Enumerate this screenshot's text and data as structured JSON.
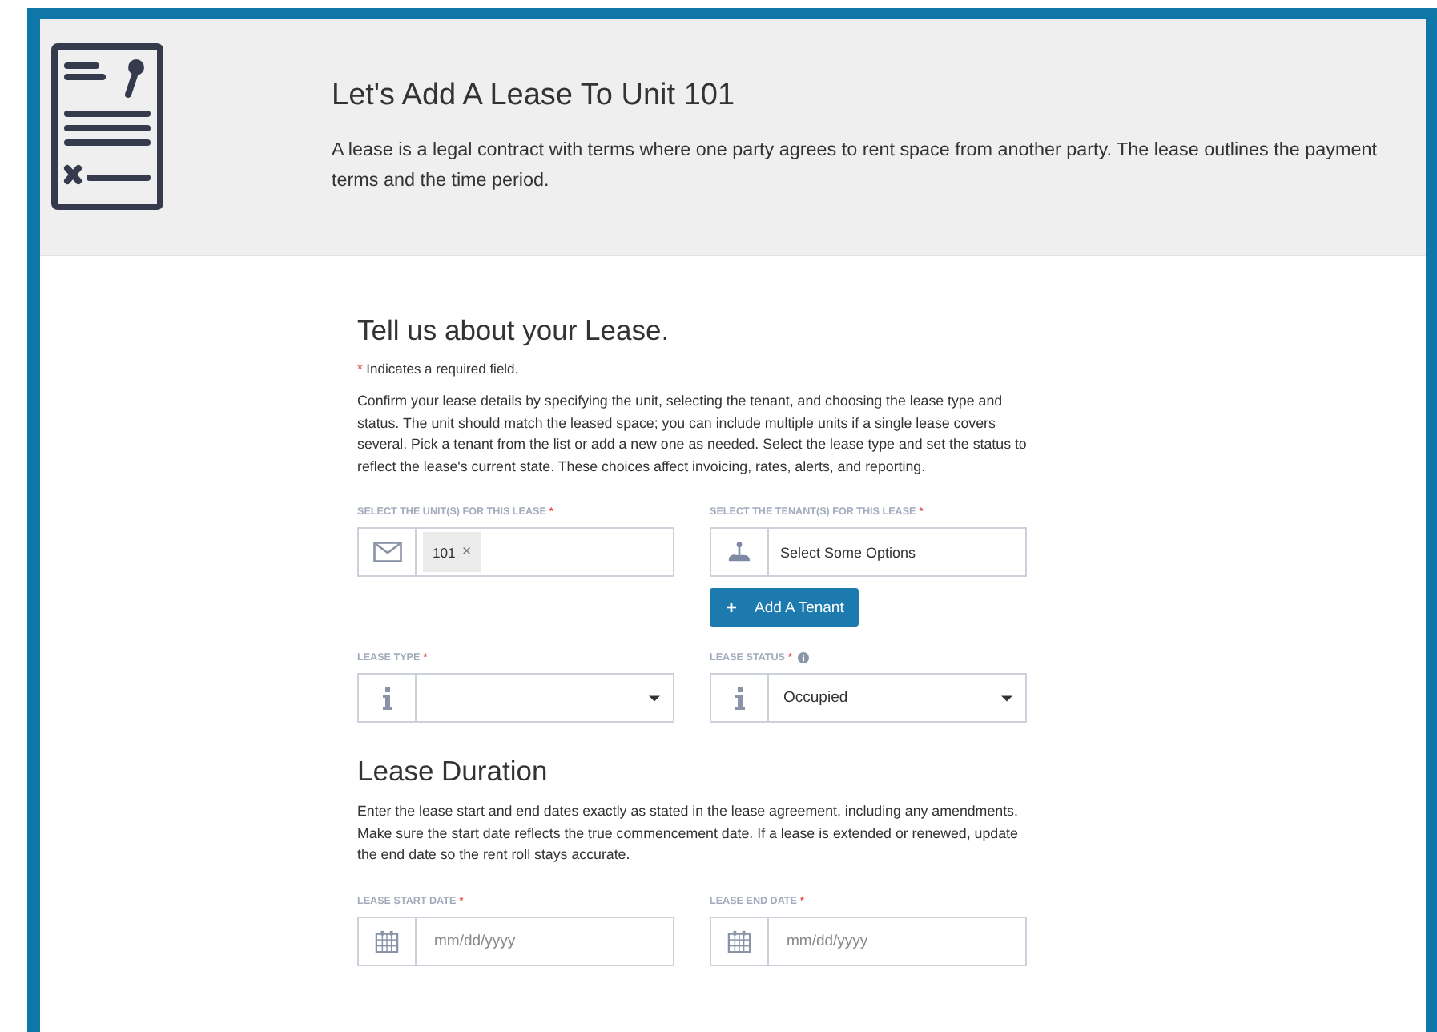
{
  "header": {
    "title": "Let's Add A Lease To Unit 101",
    "description": "A lease is a legal contract with terms where one party agrees to rent space from another party. The lease outlines the payment terms and the time period."
  },
  "sections": [
    {
      "heading": "Tell us about your Lease.",
      "required_note": "Indicates a required field.",
      "required_mark": "*",
      "description": "Confirm your lease details by specifying the unit, selecting the tenant, and choosing the lease type and status. The unit should match the leased space; you can include multiple units if a single lease covers several. Pick a tenant from the list or add a new one as needed. Select the lease type and set the status to reflect the lease's current state. These choices affect invoicing, rates, alerts, and reporting.",
      "fields": [
        {
          "label": "SELECT THE UNIT(S) FOR THIS LEASE",
          "required": true,
          "info": false,
          "kind": "tags",
          "tags": [
            {
              "text": "101",
              "remove": "×"
            }
          ]
        },
        {
          "label": "SELECT THE TENANT(S) FOR THIS LEASE",
          "required": true,
          "info": false,
          "kind": "tags",
          "placeholder": "Select Some Options",
          "button": {
            "icon": "+",
            "label": "Add A Tenant"
          }
        },
        {
          "label": "LEASE TYPE",
          "required": true,
          "info": false,
          "kind": "select"
        },
        {
          "label": "LEASE STATUS",
          "required": true,
          "info": true,
          "kind": "select",
          "value": "Occupied"
        }
      ]
    },
    {
      "heading": "Lease Duration",
      "description": "Enter the lease start and end dates exactly as stated in the lease agreement, including any amendments. Make sure the start date reflects the true commencement date. If a lease is extended or renewed, update the end date so the rent roll stays accurate.",
      "fields": [
        {
          "label": "LEASE START DATE",
          "required": true,
          "info": false,
          "kind": "date",
          "placeholder": "mm/dd/yyyy"
        },
        {
          "label": "LEASE END DATE",
          "required": true,
          "info": false,
          "kind": "date",
          "placeholder": "mm/dd/yyyy"
        }
      ]
    }
  ]
}
